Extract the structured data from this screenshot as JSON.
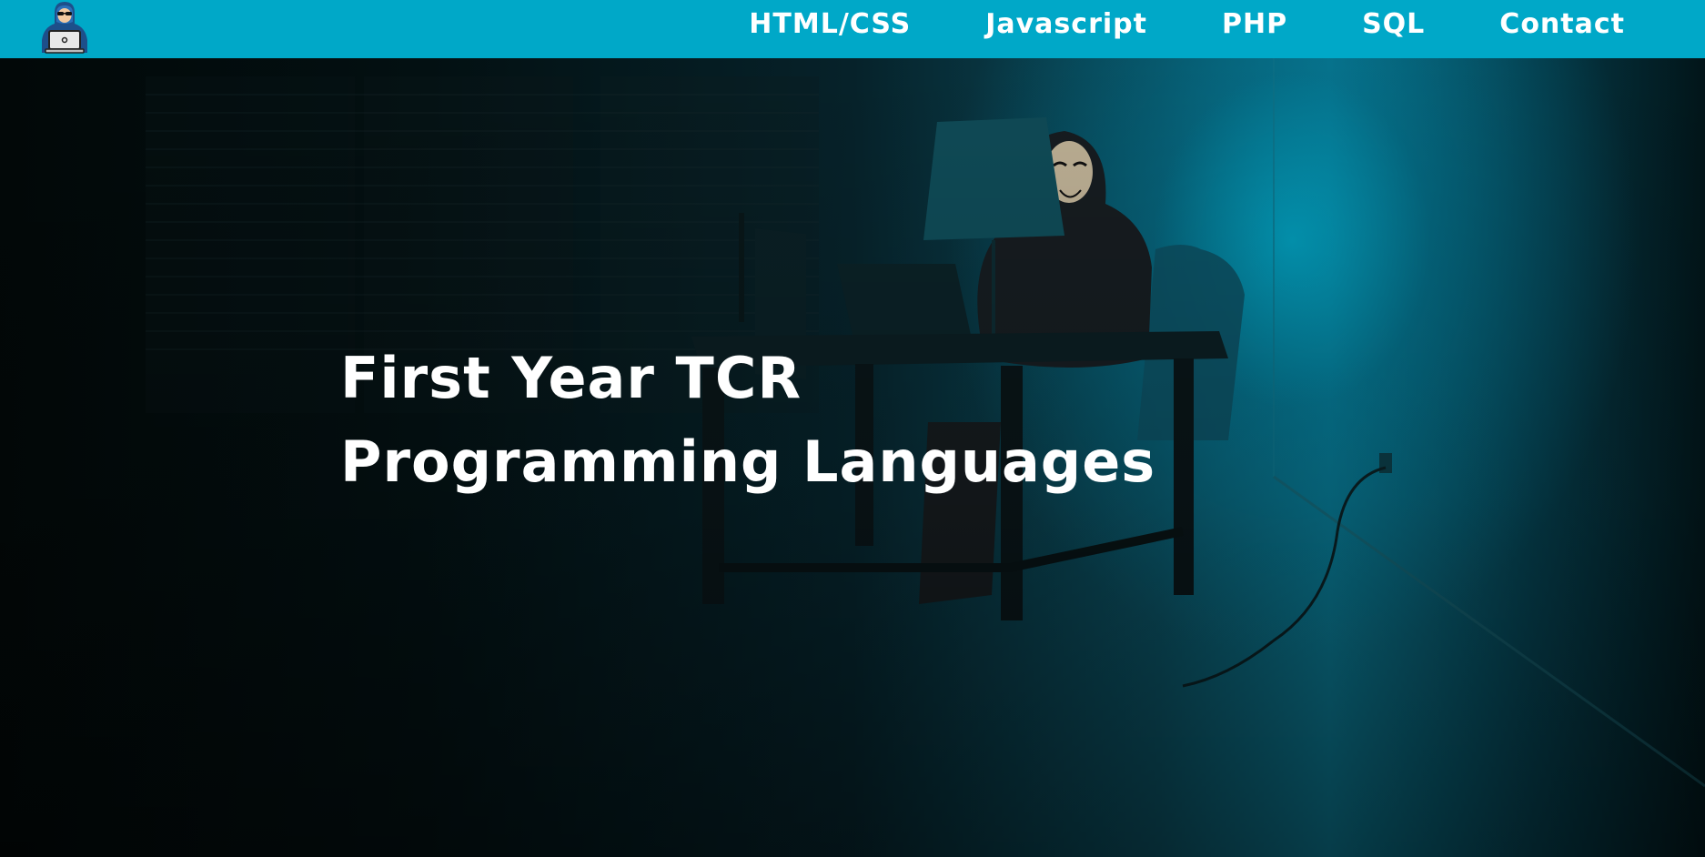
{
  "header": {
    "logo_icon": "hacker-with-laptop-icon",
    "nav": [
      {
        "label": "HTML/CSS"
      },
      {
        "label": "Javascript"
      },
      {
        "label": "PHP"
      },
      {
        "label": "SQL"
      },
      {
        "label": "Contact"
      }
    ]
  },
  "hero": {
    "title_line1": "First Year TCR",
    "title_line2": "Programming Languages",
    "background_image": "hooded-hacker-at-desk-in-dark-room"
  },
  "colors": {
    "navbar": "#00a8c8",
    "text": "#ffffff",
    "hero_glow": "#00a8c8"
  }
}
